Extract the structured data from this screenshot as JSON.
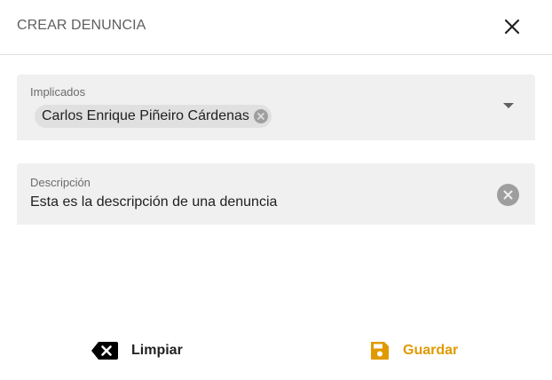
{
  "dialog": {
    "title": "CREAR DENUNCIA",
    "close_icon": "close-icon"
  },
  "implicados": {
    "label": "Implicados",
    "chips": [
      {
        "label": "Carlos Enrique Piñeiro Cárdenas"
      }
    ],
    "dropdown_icon": "arrow-drop-down-icon"
  },
  "descripcion": {
    "label": "Descripción",
    "value": "Esta es la descripción de una denuncia",
    "clear_icon": "clear-circle-icon"
  },
  "actions": {
    "limpiar": {
      "label": "Limpiar",
      "icon": "backspace-icon",
      "color": "#000000"
    },
    "guardar": {
      "label": "Guardar",
      "icon": "save-icon",
      "color": "#e09a00"
    }
  }
}
